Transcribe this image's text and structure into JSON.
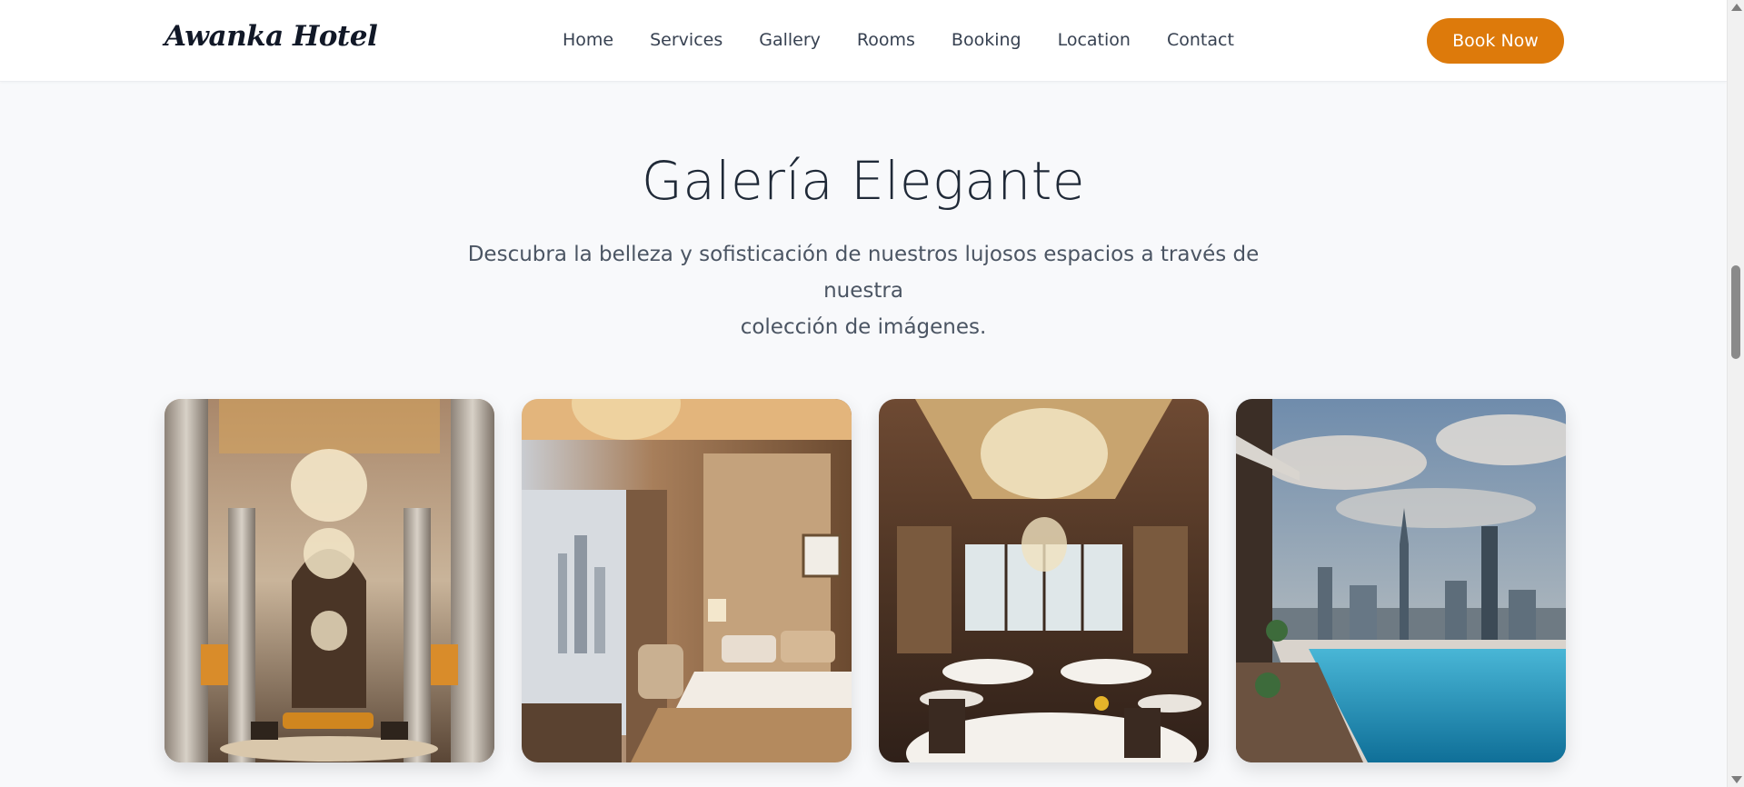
{
  "header": {
    "logo": "Awanka Hotel",
    "nav": [
      "Home",
      "Services",
      "Gallery",
      "Rooms",
      "Booking",
      "Location",
      "Contact"
    ],
    "cta_label": "Book Now",
    "cta_color": "#dd7a0b"
  },
  "gallery": {
    "title": "Galería Elegante",
    "subtitle_line1": "Descubra la belleza y sofisticación de nuestros lujosos espacios a través de nuestra",
    "subtitle_line2": "colección de imágenes."
  },
  "icons": {
    "scroll_up": "triangle-up-icon",
    "scroll_down": "triangle-down-icon"
  }
}
